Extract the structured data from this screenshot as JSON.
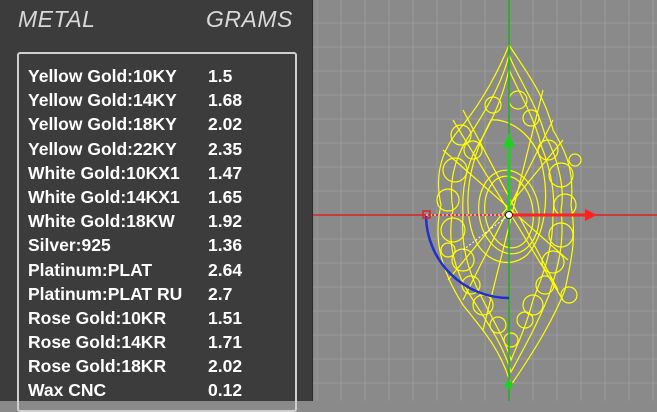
{
  "panel": {
    "header_metal": "METAL",
    "header_grams": "GRAMS",
    "rows": [
      {
        "metal": "Yellow Gold:10KY",
        "grams": "1.5"
      },
      {
        "metal": "Yellow Gold:14KY",
        "grams": "1.68"
      },
      {
        "metal": "Yellow Gold:18KY",
        "grams": "2.02"
      },
      {
        "metal": "Yellow Gold:22KY",
        "grams": "2.35"
      },
      {
        "metal": "White Gold:10KX1",
        "grams": "1.47"
      },
      {
        "metal": "White Gold:14KX1",
        "grams": "1.65"
      },
      {
        "metal": "White Gold:18KW",
        "grams": "1.92"
      },
      {
        "metal": "Silver:925",
        "grams": "1.36"
      },
      {
        "metal": "Platinum:PLAT",
        "grams": "2.64"
      },
      {
        "metal": "Platinum:PLAT RU",
        "grams": "2.7"
      },
      {
        "metal": "Rose Gold:10KR",
        "grams": "1.51"
      },
      {
        "metal": "Rose Gold:14KR",
        "grams": "1.71"
      },
      {
        "metal": "Rose Gold:18KR",
        "grams": "2.02"
      },
      {
        "metal": "Wax  CNC",
        "grams": "0.12"
      }
    ]
  },
  "viewport": {
    "background": "#8a8a8a",
    "grid_color": "#9a9a9a",
    "wireframe_color": "#ffff00",
    "x_axis_color": "#e02020",
    "y_axis_color": "#20b020",
    "arc_color": "#1f2fd0",
    "icons": [
      "gumball-move-x-arrow",
      "gumball-move-y-arrow",
      "gumball-center-point",
      "gumball-rotate-arc-handle",
      "gumball-scale-handle"
    ]
  }
}
